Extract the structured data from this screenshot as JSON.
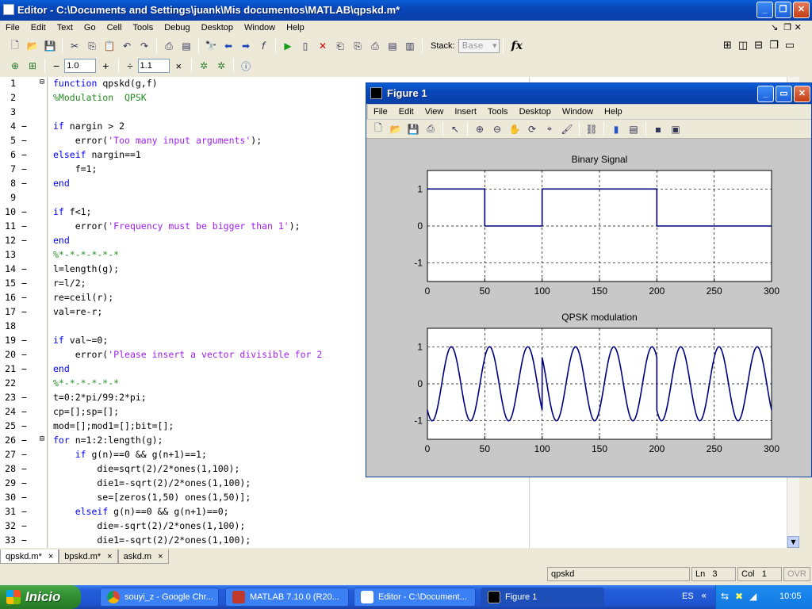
{
  "editor": {
    "title": "Editor - C:\\Documents and Settings\\juank\\Mis documentos\\MATLAB\\qpskd.m*",
    "menu": [
      "File",
      "Edit",
      "Text",
      "Go",
      "Cell",
      "Tools",
      "Debug",
      "Desktop",
      "Window",
      "Help"
    ],
    "stack_label": "Stack:",
    "stack_value": "Base",
    "fx_label": "fx",
    "cell_toolbar": {
      "minus": "−",
      "value1": "1.0",
      "plus": "+",
      "divide": "÷",
      "value2": "1.1",
      "times": "×"
    },
    "lines": [
      {
        "n": "1",
        "dash": "",
        "fold": "⊟",
        "html": "<span class='kw'>function</span> qpskd(g,f)"
      },
      {
        "n": "2",
        "dash": "",
        "fold": "",
        "html": "<span class='cm'>%Modulation  QPSK</span>"
      },
      {
        "n": "3",
        "dash": "",
        "fold": "",
        "html": ""
      },
      {
        "n": "4",
        "dash": "−",
        "fold": "",
        "html": "<span class='kw'>if</span> nargin &gt; 2"
      },
      {
        "n": "5",
        "dash": "−",
        "fold": "",
        "html": "    error(<span class='str'>'Too many input arguments'</span>);"
      },
      {
        "n": "6",
        "dash": "−",
        "fold": "",
        "html": "<span class='kw'>elseif</span> nargin==1"
      },
      {
        "n": "7",
        "dash": "−",
        "fold": "",
        "html": "    f=1;"
      },
      {
        "n": "8",
        "dash": "−",
        "fold": "",
        "html": "<span class='kw'>end</span>"
      },
      {
        "n": "9",
        "dash": "",
        "fold": "",
        "html": ""
      },
      {
        "n": "10",
        "dash": "−",
        "fold": "",
        "html": "<span class='kw'>if</span> f&lt;1;"
      },
      {
        "n": "11",
        "dash": "−",
        "fold": "",
        "html": "    error(<span class='str'>'Frequency must be bigger than 1'</span>);"
      },
      {
        "n": "12",
        "dash": "−",
        "fold": "",
        "html": "<span class='kw'>end</span>"
      },
      {
        "n": "13",
        "dash": "",
        "fold": "",
        "html": "<span class='cm'>%*-*-*-*-*-*</span>"
      },
      {
        "n": "14",
        "dash": "−",
        "fold": "",
        "html": "l=length(g);"
      },
      {
        "n": "15",
        "dash": "−",
        "fold": "",
        "html": "r=l/2;"
      },
      {
        "n": "16",
        "dash": "−",
        "fold": "",
        "html": "re=ceil(r);"
      },
      {
        "n": "17",
        "dash": "−",
        "fold": "",
        "html": "val=re-r;"
      },
      {
        "n": "18",
        "dash": "",
        "fold": "",
        "html": ""
      },
      {
        "n": "19",
        "dash": "−",
        "fold": "",
        "html": "<span class='kw'>if</span> val~=0;"
      },
      {
        "n": "20",
        "dash": "−",
        "fold": "",
        "html": "    error(<span class='str'>'Please insert a vector divisible for 2</span>"
      },
      {
        "n": "21",
        "dash": "−",
        "fold": "",
        "html": "<span class='kw'>end</span>"
      },
      {
        "n": "22",
        "dash": "",
        "fold": "",
        "html": "<span class='cm'>%*-*-*-*-*-*</span>"
      },
      {
        "n": "23",
        "dash": "−",
        "fold": "",
        "html": "t=0:2*pi/99:2*pi;"
      },
      {
        "n": "24",
        "dash": "−",
        "fold": "",
        "html": "cp=[];sp=[];"
      },
      {
        "n": "25",
        "dash": "−",
        "fold": "",
        "html": "mod=[];mod1=[];bit=[];"
      },
      {
        "n": "26",
        "dash": "−",
        "fold": "⊟",
        "html": "<span class='kw'>for</span> n=1:2:length(g);"
      },
      {
        "n": "27",
        "dash": "−",
        "fold": "",
        "html": "    <span class='kw'>if</span> g(n)==0 &amp;&amp; g(n+1)==1;"
      },
      {
        "n": "28",
        "dash": "−",
        "fold": "",
        "html": "        die=sqrt(2)/2*ones(1,100);"
      },
      {
        "n": "29",
        "dash": "−",
        "fold": "",
        "html": "        die1=-sqrt(2)/2*ones(1,100);"
      },
      {
        "n": "30",
        "dash": "−",
        "fold": "",
        "html": "        se=[zeros(1,50) ones(1,50)];"
      },
      {
        "n": "31",
        "dash": "−",
        "fold": "",
        "html": "    <span class='kw'>elseif</span> g(n)==0 &amp;&amp; g(n+1)==0;"
      },
      {
        "n": "32",
        "dash": "−",
        "fold": "",
        "html": "        die=-sqrt(2)/2*ones(1,100);"
      },
      {
        "n": "33",
        "dash": "−",
        "fold": "",
        "html": "        die1=-sqrt(2)/2*ones(1,100);"
      }
    ],
    "tabs": [
      {
        "label": "qpskd.m*",
        "close": "×",
        "active": true
      },
      {
        "label": "bpskd.m*",
        "close": "×",
        "active": false
      },
      {
        "label": "askd.m",
        "close": "×",
        "active": false
      }
    ],
    "status": {
      "function": "qpskd",
      "ln_label": "Ln",
      "ln": "3",
      "col_label": "Col",
      "col": "1",
      "ovr": "OVR"
    }
  },
  "figure": {
    "title": "Figure 1",
    "menu": [
      "File",
      "Edit",
      "View",
      "Insert",
      "Tools",
      "Desktop",
      "Window",
      "Help"
    ]
  },
  "chart_data": [
    {
      "type": "line",
      "title": "Binary Signal",
      "xlim": [
        0,
        300
      ],
      "ylim": [
        -1.5,
        1.5
      ],
      "xticks": [
        0,
        50,
        100,
        150,
        200,
        250,
        300
      ],
      "yticks": [
        1,
        0,
        -1
      ],
      "grid": "dashed",
      "series": [
        {
          "color": "#00007f",
          "x": [
            0,
            50,
            50,
            100,
            100,
            200,
            200,
            300
          ],
          "y": [
            1,
            1,
            0,
            0,
            1,
            1,
            0,
            0
          ]
        }
      ]
    },
    {
      "type": "line",
      "title": "QPSK modulation",
      "xlim": [
        0,
        300
      ],
      "ylim": [
        -1.5,
        1.5
      ],
      "xticks": [
        0,
        50,
        100,
        150,
        200,
        250,
        300
      ],
      "yticks": [
        1,
        0,
        -1
      ],
      "grid": "dashed",
      "series": [
        {
          "color": "#00007f",
          "segments": [
            {
              "x0": 0,
              "x1": 100,
              "phase_deg": 225
            },
            {
              "x0": 100,
              "x1": 200,
              "phase_deg": 135
            },
            {
              "x0": 200,
              "x1": 300,
              "phase_deg": 225
            }
          ],
          "period": 33.3333,
          "amplitude": 1
        }
      ]
    }
  ],
  "taskbar": {
    "start": "Inicio",
    "tasks": [
      {
        "label": "souyi_z - Google Chr...",
        "active": false
      },
      {
        "label": "MATLAB 7.10.0 (R20...",
        "active": false
      },
      {
        "label": "Editor - C:\\Document...",
        "active": false
      },
      {
        "label": "Figure 1",
        "active": true
      }
    ],
    "lang": "ES",
    "clock": "10:05"
  }
}
